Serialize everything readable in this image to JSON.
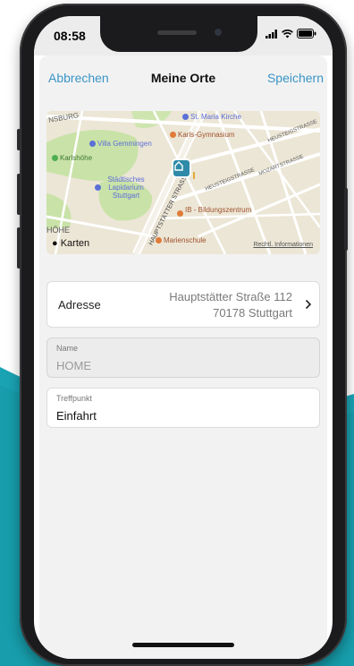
{
  "status": {
    "time": "08:58"
  },
  "nav": {
    "cancel": "Abbrechen",
    "title": "Meine Orte",
    "save": "Speichern"
  },
  "map": {
    "labels": {
      "st_maria": "St. Maria Kirche",
      "karls_gym": "Karls-Gymnasium",
      "villa": "Villa Gemmingen",
      "karlshoehe": "Karlshöhe",
      "lapidarium": "Städtisches Lapidarium Stuttgart",
      "ib": "IB - Bildungszentrum",
      "marienschule": "Marienschule",
      "hauptstaetter_street": "HAUPTSTÄTTER STRASSE",
      "heusteig_1": "HEUSTEIGSTRASSE",
      "heusteig_2": "HEUSTEIGSTRASSE",
      "mozart": "MOZARTSTRASSE",
      "hoehe": "HÖHE",
      "top_left": "NSBURG"
    },
    "brand": "Karten",
    "legal": "Rechtl. Informationen",
    "colors": {
      "park": "#c9e2a8",
      "roads": "#ffffff",
      "pin": "#2e8aa8",
      "poi_blue": "#5b6fd6",
      "poi_orange": "#e07b39"
    }
  },
  "address": {
    "label": "Adresse",
    "line1": "Hauptstätter Straße 112",
    "line2": "70178 Stuttgart"
  },
  "fields": {
    "name": {
      "label": "Name",
      "value": "HOME"
    },
    "meeting": {
      "label": "Treffpunkt",
      "value": "Einfahrt"
    }
  },
  "colors": {
    "accent": "#3a95c7",
    "background_wave": "#1aa3b3"
  }
}
